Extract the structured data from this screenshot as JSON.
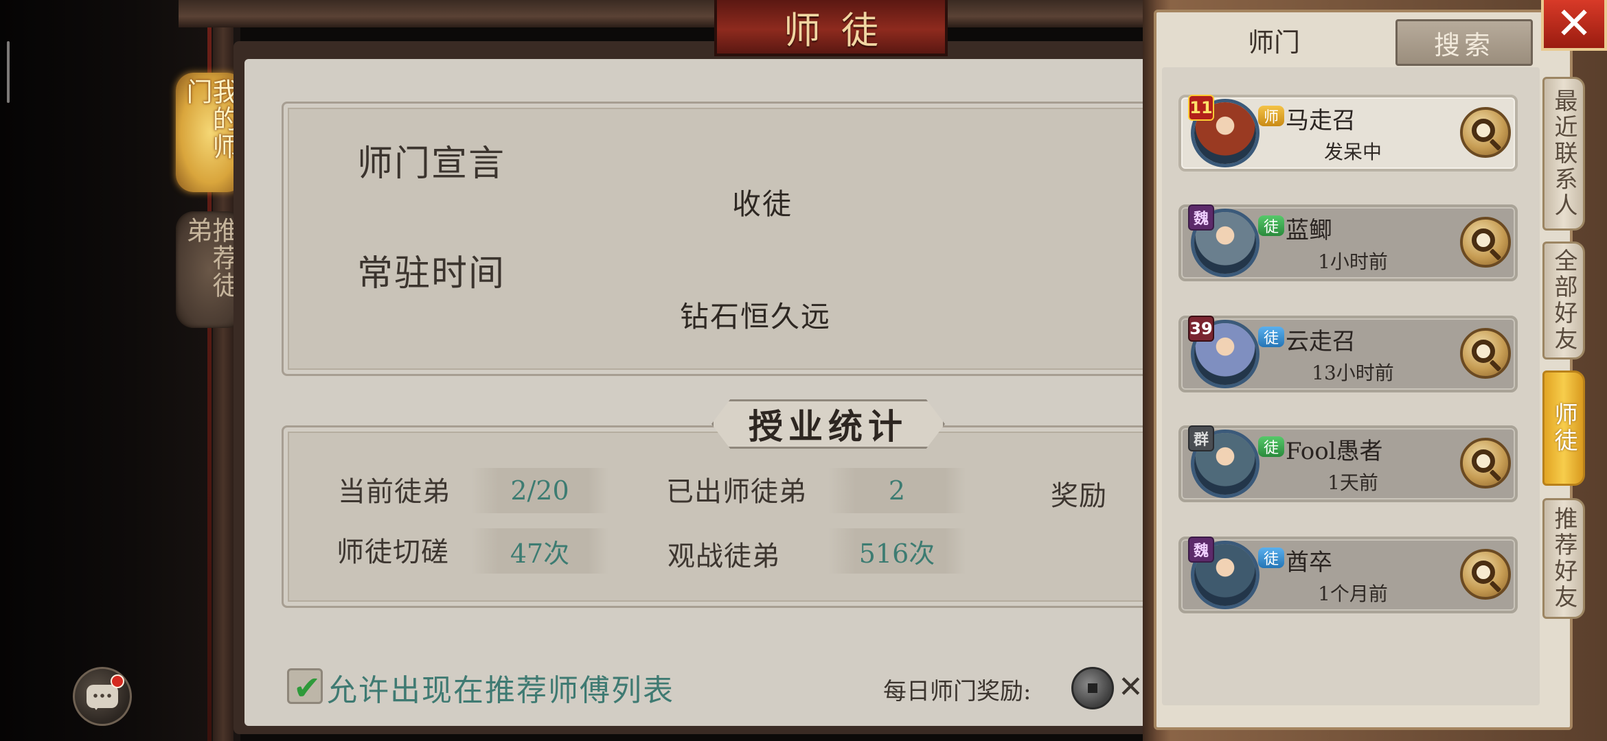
{
  "title": "师徒",
  "left_tabs": [
    {
      "label": "我的师门",
      "active": true
    },
    {
      "label": "推荐徒弟",
      "active": false
    }
  ],
  "declaration": {
    "heading1": "师门宣言",
    "value1": "收徒",
    "heading2": "常驻时间",
    "value2": "钻石恒久远"
  },
  "stats": {
    "banner": "授业统计",
    "current_disciples_label": "当前徒弟",
    "current_disciples_value": "2/20",
    "graduated_label": "已出师徒弟",
    "graduated_value": "2",
    "reward_label": "奖励",
    "sparring_label": "师徒切磋",
    "sparring_value": "47次",
    "watch_label": "观战徒弟",
    "watch_value": "516次"
  },
  "footer": {
    "allow_label": "允许出现在推荐师傅列表",
    "allow_checked": true,
    "daily_reward_label": "每日师门奖励:",
    "multiplier": "✕"
  },
  "right_panel": {
    "tab_label": "师门",
    "search_label": "搜索",
    "close_icon": "close-icon",
    "side_tabs": [
      {
        "label": "最近联系人",
        "active": false
      },
      {
        "label": "全部好友",
        "active": false
      },
      {
        "label": "师徒",
        "active": true
      },
      {
        "label": "推荐好友",
        "active": false
      }
    ],
    "contacts": [
      {
        "level": "11",
        "level_style": "red",
        "relation": "师",
        "relation_style": "gold",
        "name": "马走召",
        "status": "发呆中",
        "highlight": true,
        "avatar_color": "#9a3a22"
      },
      {
        "level": "魏",
        "level_style": "purple",
        "relation": "徒",
        "relation_style": "green",
        "name": "蓝鲫",
        "status": "1小时前",
        "highlight": false,
        "avatar_color": "#6a7f8e"
      },
      {
        "level": "39",
        "level_style": "dark",
        "relation": "徒",
        "relation_style": "blue",
        "name": "云走召",
        "status": "13小时前",
        "highlight": false,
        "avatar_color": "#7f8fc0"
      },
      {
        "level": "群",
        "level_style": "grey",
        "relation": "徒",
        "relation_style": "green",
        "name": "Fool愚者",
        "status": "1天前",
        "highlight": false,
        "avatar_color": "#4f6a7a"
      },
      {
        "level": "魏",
        "level_style": "purple",
        "relation": "徒",
        "relation_style": "blue",
        "name": "酋卒",
        "status": "1个月前",
        "highlight": false,
        "avatar_color": "#3f5a6e"
      }
    ]
  }
}
